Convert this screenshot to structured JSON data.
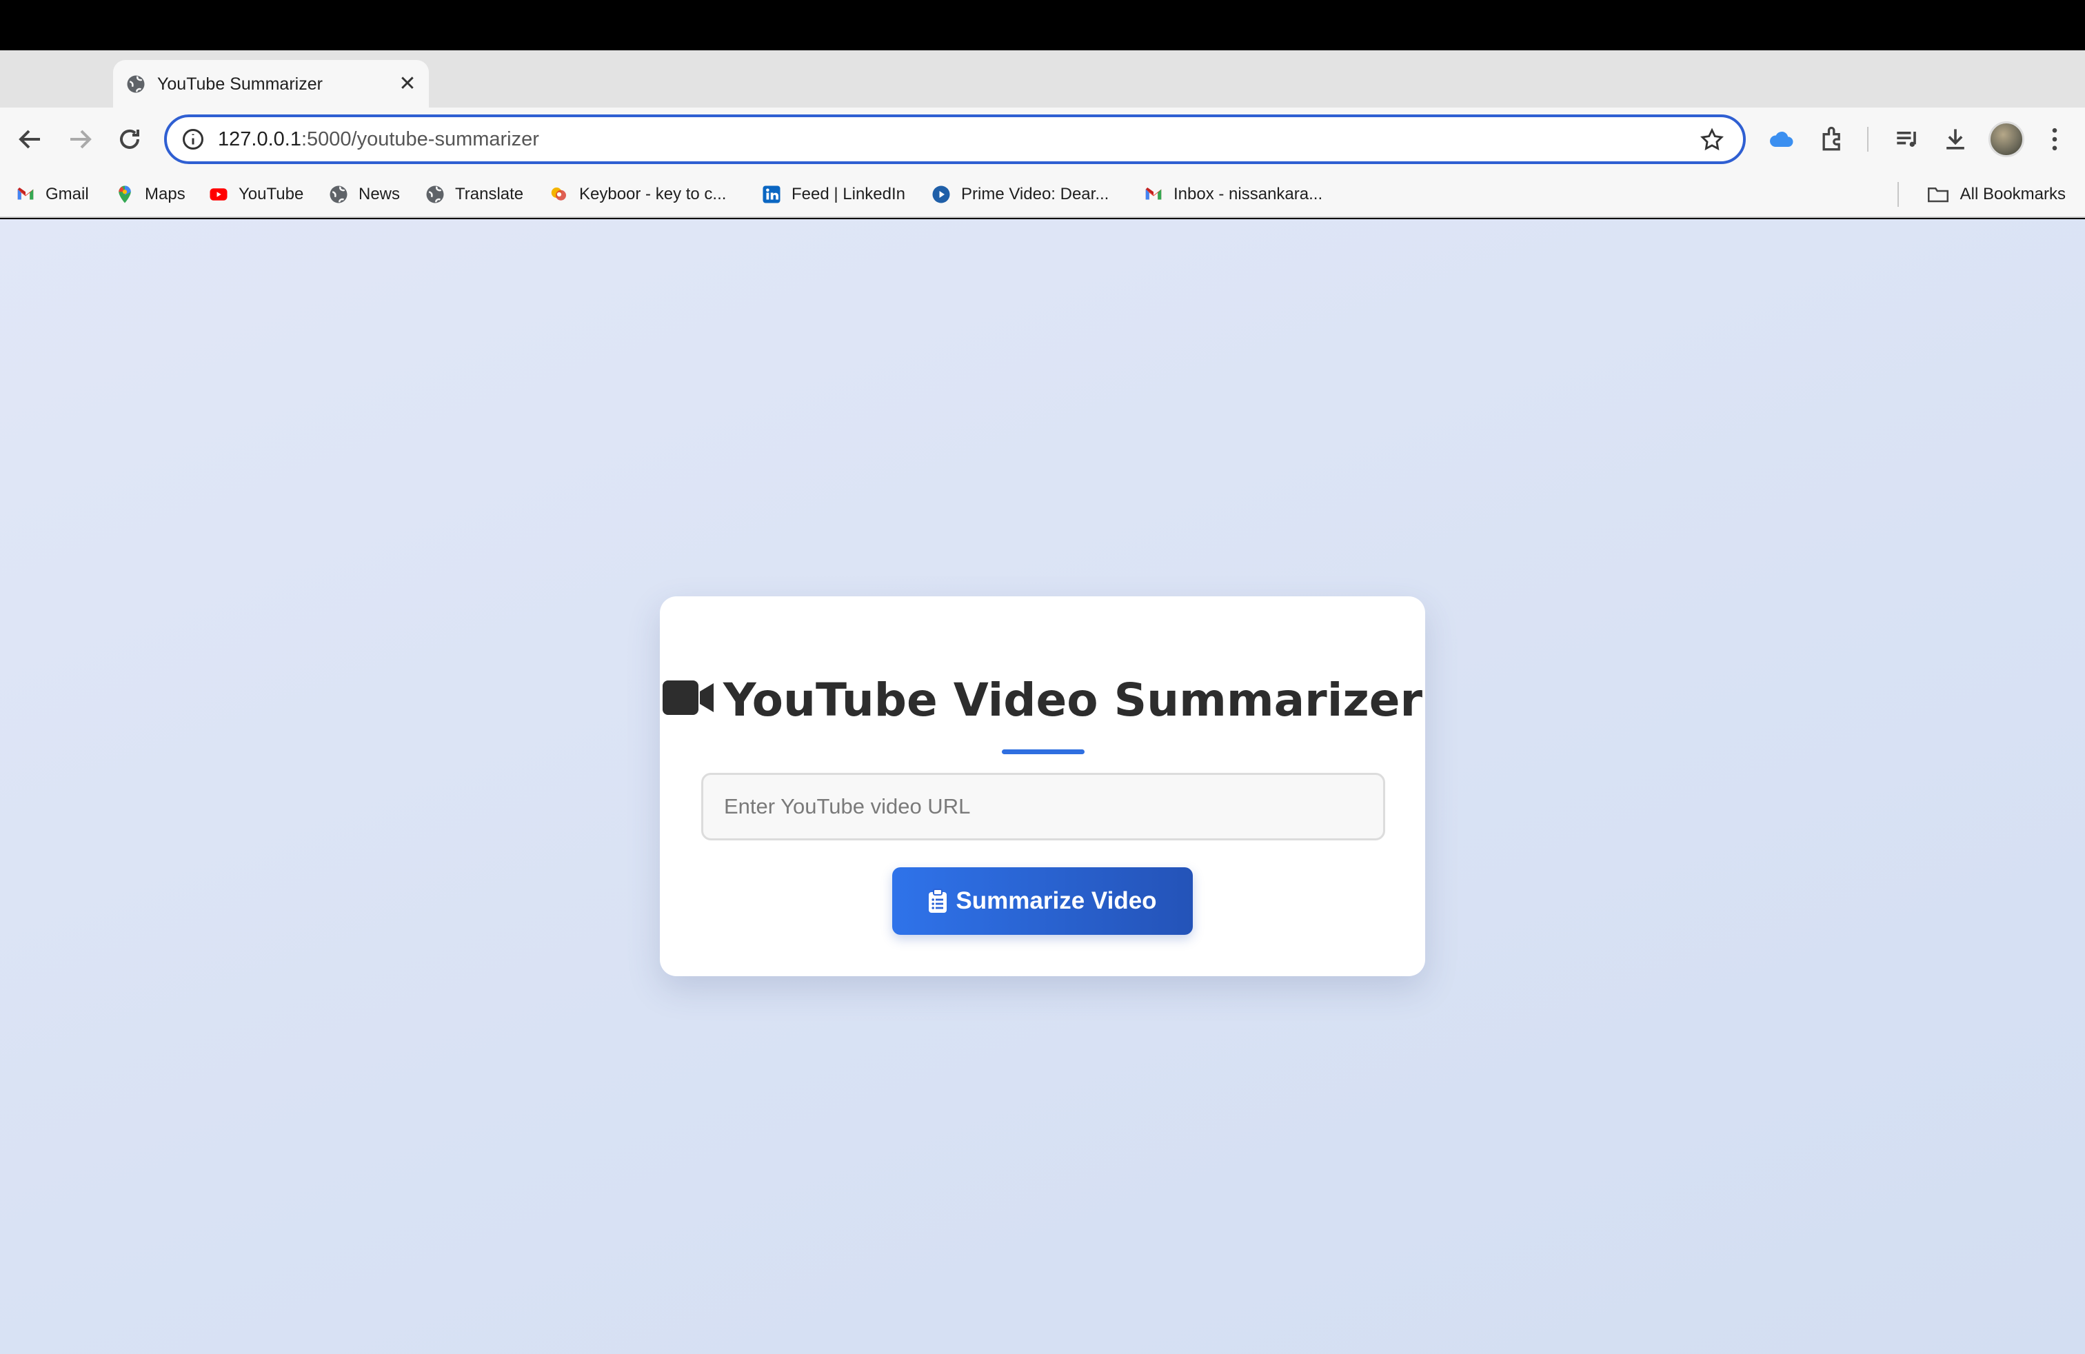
{
  "browser": {
    "tab": {
      "title": "YouTube Summarizer",
      "close": "✕"
    },
    "new_tab": "+",
    "address": {
      "host": "127.0.0.1",
      "path": ":5000/youtube-summarizer"
    }
  },
  "bookmarks": {
    "items": [
      {
        "label": "Gmail",
        "icon": "gmail-icon"
      },
      {
        "label": "Maps",
        "icon": "maps-icon"
      },
      {
        "label": "YouTube",
        "icon": "youtube-icon"
      },
      {
        "label": "News",
        "icon": "globe-icon"
      },
      {
        "label": "Translate",
        "icon": "globe-icon"
      },
      {
        "label": "Keyboor - key to c...",
        "icon": "keyboor-icon"
      },
      {
        "label": "Feed | LinkedIn",
        "icon": "linkedin-icon"
      },
      {
        "label": "Prime Video: Dear...",
        "icon": "prime-video-icon"
      },
      {
        "label": "Inbox - nissankara...",
        "icon": "gmail-icon"
      }
    ],
    "all_label": "All Bookmarks"
  },
  "app": {
    "title": "YouTube Video Summarizer",
    "title_icon": "video-camera-icon",
    "url_placeholder": "Enter YouTube video URL",
    "url_value": "",
    "submit_label": "Summarize Video",
    "submit_icon": "clipboard-icon",
    "accent": "#2f6fe0"
  }
}
